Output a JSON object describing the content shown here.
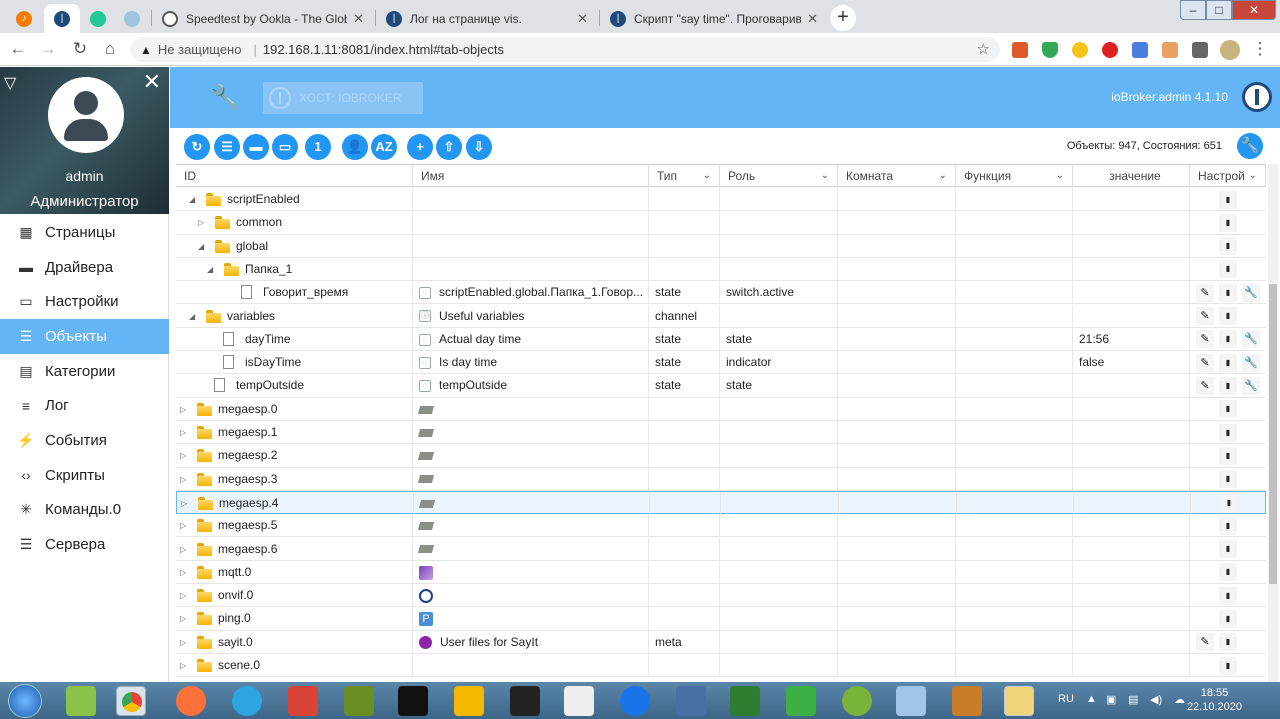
{
  "browser": {
    "tabs": [
      {
        "title": "",
        "icon": "app-icon"
      },
      {
        "title": "",
        "icon": "iobroker-icon"
      },
      {
        "title": "",
        "icon": "green-app-icon"
      },
      {
        "title": "",
        "icon": "speedometer-icon"
      },
      {
        "title": "Speedtest by Ookla - The Global",
        "icon": "speedtest-icon"
      },
      {
        "title": "Лог на странице vis.",
        "icon": "iobroker-icon"
      },
      {
        "title": "Скрипт \"say time\". Проговарива",
        "icon": "iobroker-icon"
      }
    ],
    "address": {
      "security": "Не защищено",
      "url": "192.168.1.11:8081/index.html#tab-objects"
    },
    "window_controls": [
      "–",
      "□",
      "✕"
    ]
  },
  "sidebar": {
    "user": "admin",
    "role": "Администратор",
    "items": [
      {
        "label": "Страницы",
        "icon": "grid-icon",
        "glyph": "▦"
      },
      {
        "label": "Драйвера",
        "icon": "store-icon",
        "glyph": "▬"
      },
      {
        "label": "Настройки",
        "icon": "keyboard-icon",
        "glyph": "▭"
      },
      {
        "label": "Объекты",
        "icon": "list-icon",
        "glyph": "☰"
      },
      {
        "label": "Категории",
        "icon": "categories-icon",
        "glyph": "▤"
      },
      {
        "label": "Лог",
        "icon": "log-icon",
        "glyph": "≡"
      },
      {
        "label": "События",
        "icon": "flash-icon",
        "glyph": "⚡"
      },
      {
        "label": "Скрипты",
        "icon": "code-icon",
        "glyph": "‹›"
      },
      {
        "label": "Команды.0",
        "icon": "snowflake-icon",
        "glyph": "✳"
      },
      {
        "label": "Сервера",
        "icon": "server-icon",
        "glyph": "☰"
      }
    ],
    "active_index": 3
  },
  "header": {
    "host": "ХОСТ: IOBROKER",
    "version": "ioBroker.admin 4.1.10"
  },
  "toolbar": {
    "stats": "Объекты: 947, Состояния: 651",
    "buttons": [
      {
        "name": "refresh-button",
        "glyph": "↻"
      },
      {
        "name": "list-view-button",
        "glyph": "☰"
      },
      {
        "name": "collapse-folders-button",
        "glyph": "▬"
      },
      {
        "name": "expand-folders-button",
        "glyph": "▭"
      },
      {
        "name": "tree-level-button",
        "glyph": "1"
      },
      {
        "name": "user-filter-button",
        "glyph": "👤"
      },
      {
        "name": "sort-az-button",
        "glyph": "AZ"
      },
      {
        "name": "add-object-button",
        "glyph": "+"
      },
      {
        "name": "upload-button",
        "glyph": "⇧"
      },
      {
        "name": "download-button",
        "glyph": "⇩"
      }
    ]
  },
  "table": {
    "headers": [
      "ID",
      "Имя",
      "Тип",
      "Роль",
      "Комната",
      "Функция",
      "значение",
      "Настрой"
    ],
    "rows": [
      {
        "id": "scriptEnabled",
        "level": 1,
        "kind": "folder",
        "toggle": "open",
        "name": "",
        "type": "",
        "role": "",
        "value": "",
        "actions": [
          "del"
        ]
      },
      {
        "id": "common",
        "level": 2,
        "kind": "folder",
        "toggle": "closed",
        "name": "",
        "type": "",
        "role": "",
        "value": "",
        "actions": [
          "del"
        ]
      },
      {
        "id": "global",
        "level": 2,
        "kind": "folder",
        "toggle": "open",
        "name": "",
        "type": "",
        "role": "",
        "value": "",
        "actions": [
          "del"
        ]
      },
      {
        "id": "Папка_1",
        "level": 3,
        "kind": "folder",
        "toggle": "open",
        "name": "",
        "type": "",
        "role": "",
        "value": "",
        "actions": [
          "del"
        ]
      },
      {
        "id": "Говорит_время",
        "level": 4,
        "kind": "file",
        "toggle": "",
        "name": "scriptEnabled.global.Папка_1.Говор...",
        "name_icon": "state",
        "type": "state",
        "role": "switch.active",
        "value": "",
        "actions": [
          "edit",
          "del",
          "wrench"
        ]
      },
      {
        "id": "variables",
        "level": 1,
        "kind": "folder",
        "toggle": "open",
        "name": "Useful variables",
        "name_icon": "channel",
        "type": "channel",
        "role": "",
        "value": "",
        "actions": [
          "edit",
          "del"
        ]
      },
      {
        "id": "dayTime",
        "level": 2,
        "kind": "file",
        "toggle": "",
        "name": "Actual day time",
        "name_icon": "state",
        "type": "state",
        "role": "state",
        "value": "21:56",
        "actions": [
          "edit",
          "del",
          "wrench"
        ]
      },
      {
        "id": "isDayTime",
        "level": 2,
        "kind": "file",
        "toggle": "",
        "name": "Is day time",
        "name_icon": "state",
        "type": "state",
        "role": "indicator",
        "value": "false",
        "actions": [
          "edit",
          "del",
          "wrench"
        ]
      },
      {
        "id": "tempOutside",
        "level": 1,
        "kind": "file",
        "toggle": "",
        "name": "tempOutside",
        "name_icon": "state",
        "type": "state",
        "role": "state",
        "value": "",
        "actions": [
          "edit",
          "del",
          "wrench"
        ]
      },
      {
        "id": "megaesp.0",
        "level": 0,
        "kind": "folder",
        "toggle": "closed",
        "name": "",
        "name_icon": "board",
        "type": "",
        "role": "",
        "value": "",
        "actions": [
          "del"
        ]
      },
      {
        "id": "megaesp.1",
        "level": 0,
        "kind": "folder",
        "toggle": "closed",
        "name": "",
        "name_icon": "board",
        "type": "",
        "role": "",
        "value": "",
        "actions": [
          "del"
        ]
      },
      {
        "id": "megaesp.2",
        "level": 0,
        "kind": "folder",
        "toggle": "closed",
        "name": "",
        "name_icon": "board",
        "type": "",
        "role": "",
        "value": "",
        "actions": [
          "del"
        ]
      },
      {
        "id": "megaesp.3",
        "level": 0,
        "kind": "folder",
        "toggle": "closed",
        "name": "",
        "name_icon": "board",
        "type": "",
        "role": "",
        "value": "",
        "actions": [
          "del"
        ]
      },
      {
        "id": "megaesp.4",
        "level": 0,
        "kind": "folder",
        "toggle": "closed",
        "name": "",
        "name_icon": "board",
        "type": "",
        "role": "",
        "value": "",
        "actions": [
          "del"
        ],
        "selected": true
      },
      {
        "id": "megaesp.5",
        "level": 0,
        "kind": "folder",
        "toggle": "closed",
        "name": "",
        "name_icon": "board",
        "type": "",
        "role": "",
        "value": "",
        "actions": [
          "del"
        ]
      },
      {
        "id": "megaesp.6",
        "level": 0,
        "kind": "folder",
        "toggle": "closed",
        "name": "",
        "name_icon": "board",
        "type": "",
        "role": "",
        "value": "",
        "actions": [
          "del"
        ]
      },
      {
        "id": "mqtt.0",
        "level": 0,
        "kind": "folder",
        "toggle": "closed",
        "name": "",
        "name_icon": "mqtt",
        "type": "",
        "role": "",
        "value": "",
        "actions": [
          "del"
        ]
      },
      {
        "id": "onvif.0",
        "level": 0,
        "kind": "folder",
        "toggle": "closed",
        "name": "",
        "name_icon": "onvif",
        "type": "",
        "role": "",
        "value": "",
        "actions": [
          "del"
        ]
      },
      {
        "id": "ping.0",
        "level": 0,
        "kind": "folder",
        "toggle": "closed",
        "name": "",
        "name_icon": "ping",
        "type": "",
        "role": "",
        "value": "",
        "actions": [
          "del"
        ]
      },
      {
        "id": "sayit.0",
        "level": 0,
        "kind": "folder",
        "toggle": "closed",
        "name": "User files for SayIt",
        "name_icon": "sayit",
        "type": "meta",
        "role": "",
        "value": "",
        "actions": [
          "edit",
          "del"
        ]
      },
      {
        "id": "scene.0",
        "level": 0,
        "kind": "folder",
        "toggle": "closed",
        "name": "",
        "type": "",
        "role": "",
        "value": "",
        "actions": [
          "del"
        ]
      }
    ]
  },
  "taskbar": {
    "lang": "RU",
    "time": "18:55",
    "date": "22.10.2020"
  },
  "colors": {
    "accent": "#64b5f6",
    "button": "#2196f3"
  }
}
